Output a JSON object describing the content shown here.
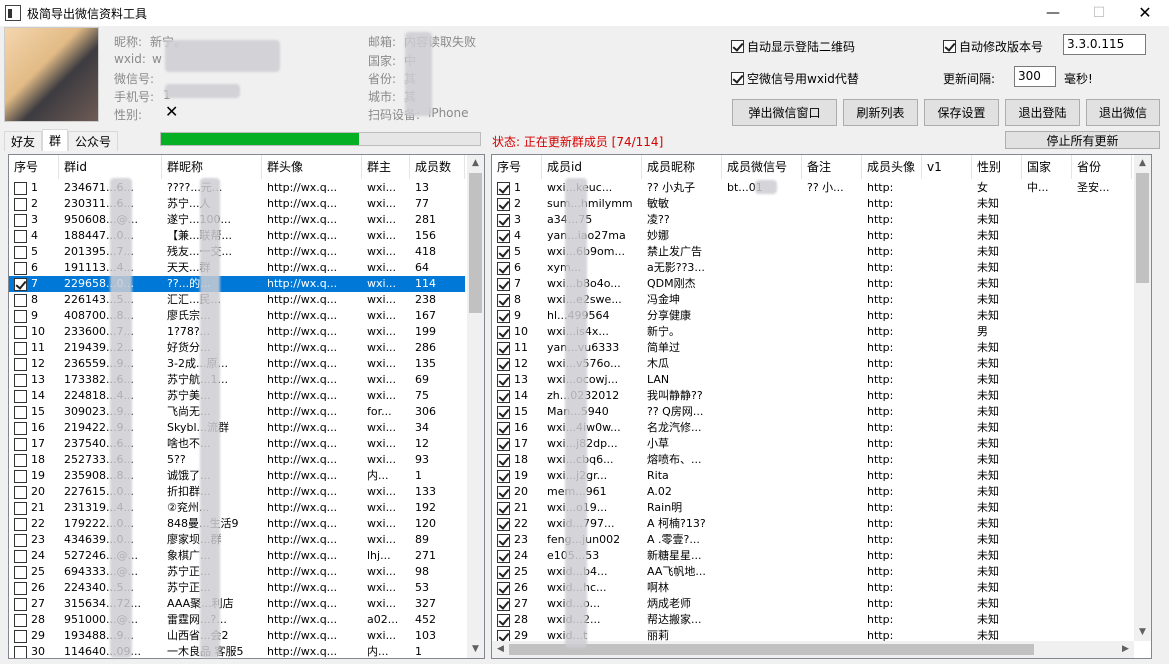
{
  "window": {
    "title": "极简导出微信资料工具",
    "min": "—",
    "max": "☐",
    "close": "✕"
  },
  "profile": {
    "nickname_label": "昵称:",
    "nickname": "新宁。",
    "wxid_label": "wxid:",
    "wxid": "w",
    "wechat_label": "微信号:",
    "wechat": "",
    "phone_label": "手机号:",
    "phone": "1",
    "gender_label": "性别:",
    "gender": "✕",
    "email_label": "邮箱:",
    "email": "内容读取失败",
    "country_label": "国家:",
    "country": "中",
    "province_label": "省份:",
    "province": "其",
    "city_label": "城市:",
    "city": "其",
    "scan_label": "扫码设备:",
    "scan": "iPhone"
  },
  "options": {
    "auto_qr": {
      "label": "自动显示登陆二维码",
      "checked": true
    },
    "auto_version": {
      "label": "自动修改版本号",
      "checked": true
    },
    "version": "3.3.0.115",
    "empty_wechat": {
      "label": "空微信号用wxid代替",
      "checked": true
    },
    "interval_label": "更新间隔:",
    "interval": "300",
    "interval_unit": "毫秒!"
  },
  "buttons": {
    "popup": "弹出微信窗口",
    "refresh": "刷新列表",
    "save": "保存设置",
    "logout": "退出登陆",
    "exit": "退出微信",
    "stop": "停止所有更新"
  },
  "tabs": [
    "好友",
    "群",
    "公众号"
  ],
  "progress": {
    "percent": 62
  },
  "status": "状态: 正在更新群成员 [74/114]",
  "groups": {
    "headers": [
      "序号",
      "群id",
      "群昵称",
      "群头像",
      "群主",
      "成员数"
    ],
    "rows": [
      [
        "1",
        "234671...6...",
        "????...元...",
        "http://wx.q...",
        "wxi...",
        "13"
      ],
      [
        "2",
        "230311...6...",
        "苏宁...人",
        "http://wx.q...",
        "wxi...",
        "77"
      ],
      [
        "3",
        "950608...@...",
        "遂宁...100...",
        "http://wx.q...",
        "wxi...",
        "281"
      ],
      [
        "4",
        "188447...0...",
        "【兼...联帮...",
        "http://wx.q...",
        "wxi...",
        "156"
      ],
      [
        "5",
        "201395...7...",
        "残友...一交...",
        "http://wx.q...",
        "wxi...",
        "418"
      ],
      [
        "6",
        "191113...4...",
        "天天...群",
        "http://wx.q...",
        "wxi...",
        "64"
      ],
      [
        "7",
        "229658...0...",
        "??...的...",
        "http://wx.q...",
        "wxi...",
        "114"
      ],
      [
        "8",
        "226143...5...",
        "汇汇...民...",
        "http://wx.q...",
        "wxi...",
        "238"
      ],
      [
        "9",
        "408700...8...",
        "廖氏宗...",
        "http://wx.q...",
        "wxi...",
        "167"
      ],
      [
        "10",
        "233600...7...",
        "1?78?...",
        "http://wx.q...",
        "wxi...",
        "199"
      ],
      [
        "11",
        "219439...2...",
        "好货分...",
        "http://wx.q...",
        "wxi...",
        "286"
      ],
      [
        "12",
        "236559...9...",
        "3-2成...原...",
        "http://wx.q...",
        "wxi...",
        "135"
      ],
      [
        "13",
        "173382...6...",
        "苏宁航...1...",
        "http://wx.q...",
        "wxi...",
        "69"
      ],
      [
        "14",
        "224818...4...",
        "苏宁美...",
        "http://wx.q...",
        "wxi...",
        "75"
      ],
      [
        "15",
        "309023...9...",
        "飞尚无...",
        "http://wx.q...",
        "for...",
        "306"
      ],
      [
        "16",
        "219422...9...",
        "Skybl...流群",
        "http://wx.q...",
        "wxi...",
        "34"
      ],
      [
        "17",
        "237540...6...",
        "啥也不...",
        "http://wx.q...",
        "wxi...",
        "12"
      ],
      [
        "18",
        "252733...6...",
        "5??",
        "http://wx.q...",
        "wxi...",
        "93"
      ],
      [
        "19",
        "235908...8...",
        "诚饿了...",
        "http://wx.q...",
        "内...",
        "1"
      ],
      [
        "20",
        "227615...0...",
        "折扣群...",
        "http://wx.q...",
        "wxi...",
        "133"
      ],
      [
        "21",
        "231319...4...",
        "②兖州...",
        "http://wx.q...",
        "wxi...",
        "192"
      ],
      [
        "22",
        "179222...0...",
        "848曼...生活9",
        "http://wx.q...",
        "wxi...",
        "120"
      ],
      [
        "23",
        "434639...0...",
        "廖家坝...群",
        "http://wx.q...",
        "wxi...",
        "89"
      ],
      [
        "24",
        "527246...@...",
        "象棋广...",
        "http://wx.q...",
        "lhj...",
        "271"
      ],
      [
        "25",
        "694333...@...",
        "苏宁正...",
        "http://wx.q...",
        "wxi...",
        "98"
      ],
      [
        "26",
        "224340...5...",
        "苏宁正...",
        "http://wx.q...",
        "wxi...",
        "53"
      ],
      [
        "27",
        "315634...72...",
        "AAA聚...利店",
        "http://wx.q...",
        "wxi...",
        "327"
      ],
      [
        "28",
        "951000...@...",
        "雷霆网...?...",
        "http://wx.q...",
        "a02...",
        "452"
      ],
      [
        "29",
        "193488...9...",
        "山西省...会2",
        "http://wx.q...",
        "wxi...",
        "103"
      ],
      [
        "30",
        "114640...09...",
        "一木良品 客服5",
        "http://wx.q...",
        "内...",
        "1"
      ]
    ]
  },
  "members": {
    "headers": [
      "序号",
      "成员id",
      "成员昵称",
      "成员微信号",
      "备注",
      "成员头像",
      "v1",
      "性别",
      "国家",
      "省份"
    ],
    "rows": [
      [
        "1",
        "wxi...keuc...",
        "?? 小丸子",
        "bt...01",
        "?? 小...",
        "http:",
        "",
        "女",
        "中...",
        "圣安..."
      ],
      [
        "2",
        "sum...hmilymm",
        "敏敏",
        "",
        "",
        "http:",
        "",
        "未知",
        "",
        ""
      ],
      [
        "3",
        "a34...75",
        "凌??",
        "",
        "",
        "http:",
        "",
        "未知",
        "",
        ""
      ],
      [
        "4",
        "yan...iao27ma",
        "妙娜",
        "",
        "",
        "http:",
        "",
        "未知",
        "",
        ""
      ],
      [
        "5",
        "wxi...6b9om...",
        "禁止发广告",
        "",
        "",
        "http:",
        "",
        "未知",
        "",
        ""
      ],
      [
        "6",
        "xym...",
        "a无影??3...",
        "",
        "",
        "http:",
        "",
        "未知",
        "",
        ""
      ],
      [
        "7",
        "wxi...b8o4o...",
        "QDM刚杰",
        "",
        "",
        "http:",
        "",
        "未知",
        "",
        ""
      ],
      [
        "8",
        "wxi...e2swe...",
        "冯金坤",
        "",
        "",
        "http:",
        "",
        "未知",
        "",
        ""
      ],
      [
        "9",
        "hl...499564",
        "分享健康",
        "",
        "",
        "http:",
        "",
        "未知",
        "",
        ""
      ],
      [
        "10",
        "wxi...is4x...",
        "新宁。",
        "",
        "",
        "http:",
        "",
        "男",
        "",
        ""
      ],
      [
        "11",
        "yan...vu6333",
        "简单过",
        "",
        "",
        "http:",
        "",
        "未知",
        "",
        ""
      ],
      [
        "12",
        "wxi...v576o...",
        "木瓜",
        "",
        "",
        "http:",
        "",
        "未知",
        "",
        ""
      ],
      [
        "13",
        "wxi...ocowj...",
        "LAN",
        "",
        "",
        "http:",
        "",
        "未知",
        "",
        ""
      ],
      [
        "14",
        "zh...0232012",
        "我叫静静??",
        "",
        "",
        "http:",
        "",
        "未知",
        "",
        ""
      ],
      [
        "15",
        "Man...5940",
        "?? Q房网...",
        "",
        "",
        "http:",
        "",
        "未知",
        "",
        ""
      ],
      [
        "16",
        "wxi...4iw0w...",
        "名龙汽修...",
        "",
        "",
        "http:",
        "",
        "未知",
        "",
        ""
      ],
      [
        "17",
        "wxi...j82dp...",
        "小草",
        "",
        "",
        "http:",
        "",
        "未知",
        "",
        ""
      ],
      [
        "18",
        "wxi...cbq6...",
        "熔喷布、...",
        "",
        "",
        "http:",
        "",
        "未知",
        "",
        ""
      ],
      [
        "19",
        "wxi...j2gr...",
        "Rita",
        "",
        "",
        "http:",
        "",
        "未知",
        "",
        ""
      ],
      [
        "20",
        "mem...961",
        "A.02",
        "",
        "",
        "http:",
        "",
        "未知",
        "",
        ""
      ],
      [
        "21",
        "wxi...o19...",
        "Rain明",
        "",
        "",
        "http:",
        "",
        "未知",
        "",
        ""
      ],
      [
        "22",
        "wxid...797...",
        "A 柯楠?13?",
        "",
        "",
        "http:",
        "",
        "未知",
        "",
        ""
      ],
      [
        "23",
        "feng...jun002",
        "A .零壹?...",
        "",
        "",
        "http:",
        "",
        "未知",
        "",
        ""
      ],
      [
        "24",
        "e105...53",
        "新糖星星...",
        "",
        "",
        "http:",
        "",
        "未知",
        "",
        ""
      ],
      [
        "25",
        "wxid...b4...",
        "AA飞帆地...",
        "",
        "",
        "http:",
        "",
        "未知",
        "",
        ""
      ],
      [
        "26",
        "wxid...hc...",
        "啊林",
        "",
        "",
        "http:",
        "",
        "未知",
        "",
        ""
      ],
      [
        "27",
        "wxid...o...",
        "炳成老师",
        "",
        "",
        "http:",
        "",
        "未知",
        "",
        ""
      ],
      [
        "28",
        "wxid...2...",
        "帮达搬家...",
        "",
        "",
        "http:",
        "",
        "未知",
        "",
        ""
      ],
      [
        "29",
        "wxid...t",
        "丽莉",
        "",
        "",
        "http:",
        "",
        "未知",
        "",
        ""
      ]
    ]
  }
}
